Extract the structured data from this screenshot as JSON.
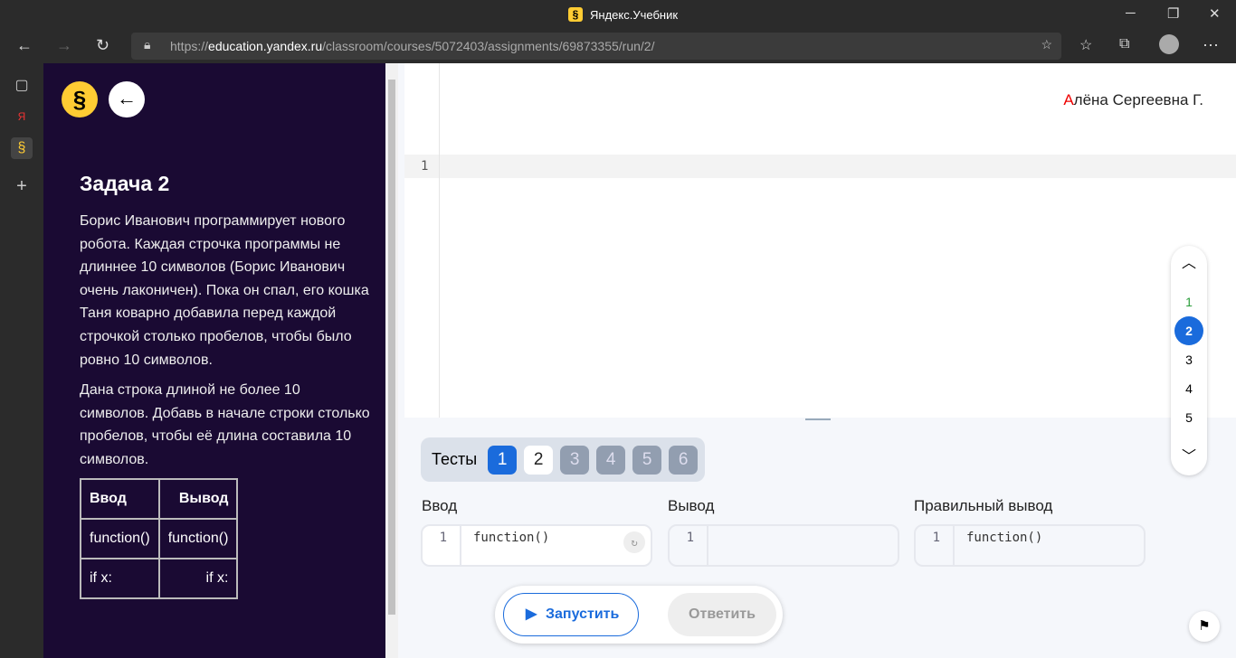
{
  "window": {
    "title": "Яндекс.Учебник"
  },
  "browser": {
    "url_prefix": "https://",
    "url_domain": "education.yandex.ru",
    "url_path": "/classroom/courses/5072403/assignments/69873355/run/2/"
  },
  "task": {
    "title": "Задача 2",
    "paragraph1": "Борис Иванович программирует нового робота. Каждая строчка программы не длиннее 10 символов (Борис Иванович очень лаконичен). Пока он спал, его кошка Таня коварно добавила перед каждой строчкой столько пробелов, чтобы было ровно 10 символов.",
    "paragraph2": "Дана строка длиной не более 10 символов. Добавь в начале строки столько пробелов, чтобы её длина составила 10 символов.",
    "table": {
      "headers": [
        "Ввод",
        "Вывод"
      ],
      "rows": [
        [
          "function()",
          "function()"
        ],
        [
          "if x:",
          "if x:"
        ]
      ]
    }
  },
  "user": {
    "initial": "А",
    "rest": "лёна Сергеевна Г."
  },
  "editor": {
    "line": "1"
  },
  "pager": {
    "items": [
      "1",
      "2",
      "3",
      "4",
      "5"
    ],
    "active": "2"
  },
  "tests": {
    "label": "Тесты",
    "items": [
      "1",
      "2",
      "3",
      "4",
      "5",
      "6"
    ]
  },
  "io": {
    "input_label": "Ввод",
    "output_label": "Вывод",
    "expected_label": "Правильный вывод",
    "input_value": "function()",
    "output_value": "",
    "expected_value": "function()",
    "line": "1"
  },
  "actions": {
    "run": "Запустить",
    "answer": "Ответить"
  }
}
